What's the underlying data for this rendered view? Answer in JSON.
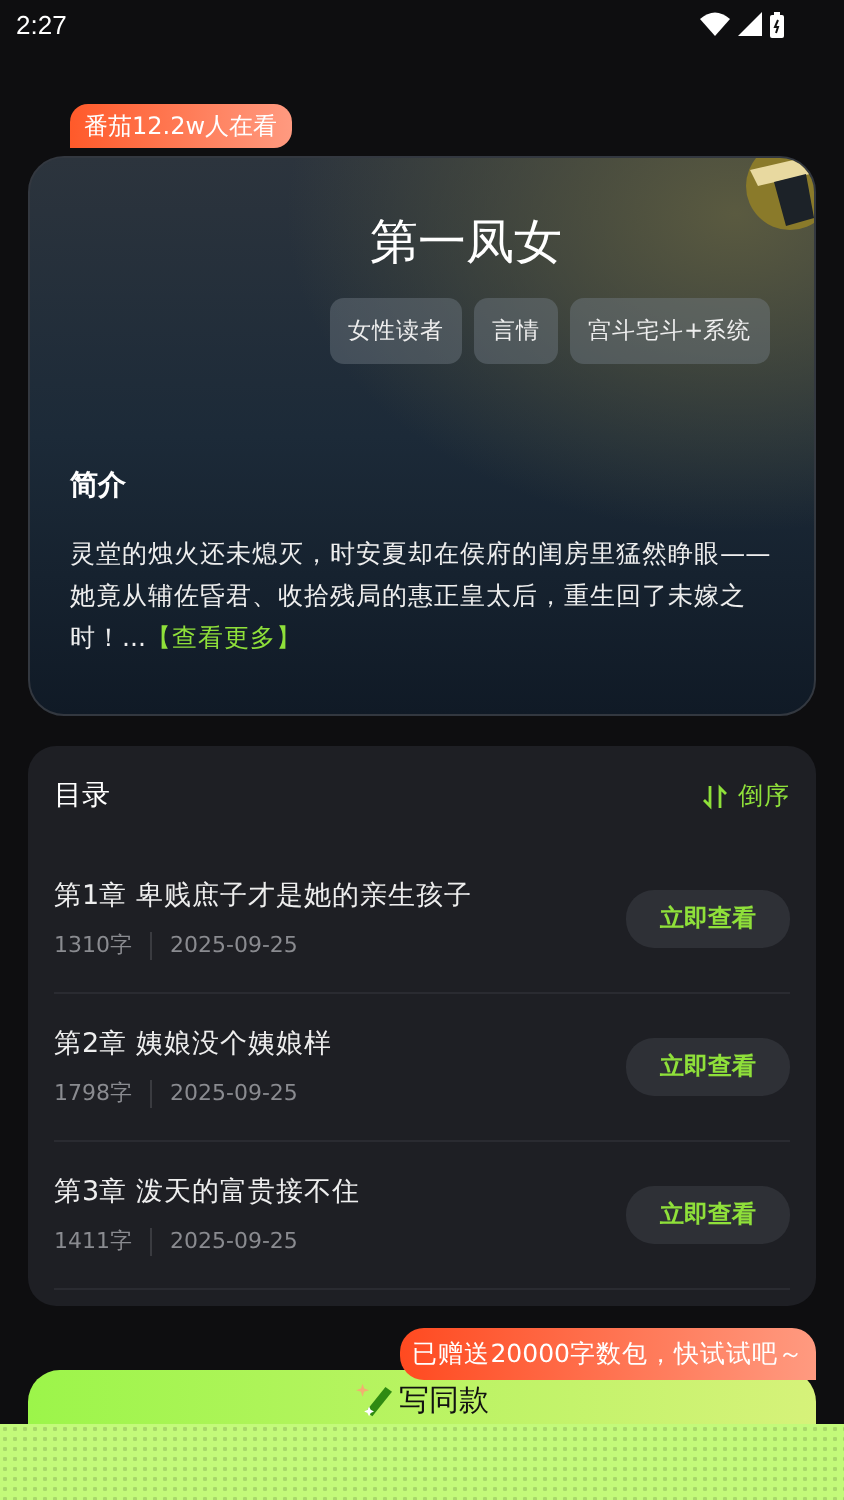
{
  "status_bar": {
    "time": "2:27"
  },
  "badge": "番茄12.2w人在看",
  "book": {
    "title": "第一凤女",
    "tags": [
      "女性读者",
      "言情",
      "宫斗宅斗+系统"
    ],
    "intro_heading": "简介",
    "intro": "灵堂的烛火还未熄灭，时安夏却在侯府的闺房里猛然睁眼—— 她竟从辅佐昏君、收拾残局的惠正皇太后，重生回了未嫁之时！...",
    "more_link": "【查看更多】"
  },
  "catalog": {
    "heading": "目录",
    "sort_label": "倒序",
    "chapters": [
      {
        "title": "第1章 卑贱庶子才是她的亲生孩子",
        "words": "1310字",
        "date": "2025-09-25",
        "action": "立即查看"
      },
      {
        "title": "第2章 姨娘没个姨娘样",
        "words": "1798字",
        "date": "2025-09-25",
        "action": "立即查看"
      },
      {
        "title": "第3章 泼天的富贵接不住",
        "words": "1411字",
        "date": "2025-09-25",
        "action": "立即查看"
      }
    ]
  },
  "gift_bubble": "已赠送20000字数包，快试试吧～",
  "write_button": "写同款"
}
